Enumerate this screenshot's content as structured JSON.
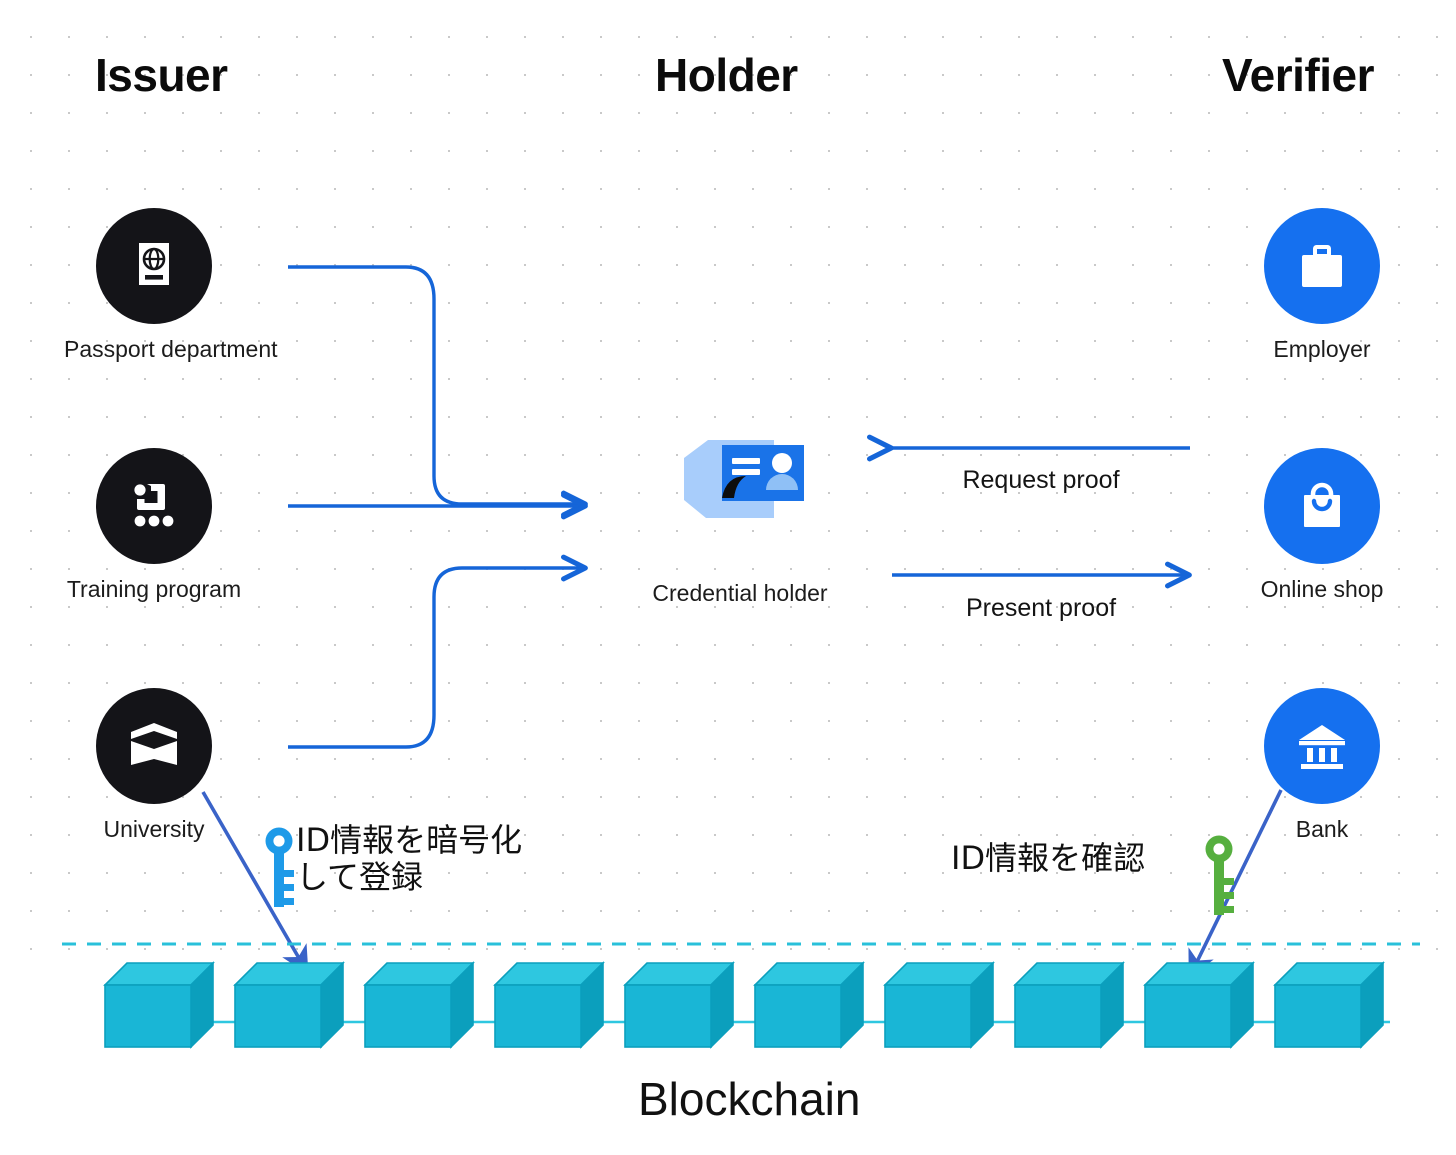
{
  "diagram": {
    "columns": [
      {
        "id": "issuer",
        "title": "Issuer"
      },
      {
        "id": "holder",
        "title": "Holder"
      },
      {
        "id": "verifier",
        "title": "Verifier"
      }
    ],
    "issuers": [
      {
        "label": "Passport department",
        "icon": "passport-icon"
      },
      {
        "label": "Training program",
        "icon": "training-icon"
      },
      {
        "label": "University",
        "icon": "graduation-cap-icon"
      }
    ],
    "holder": {
      "label": "Credential holder",
      "icon": "id-card-in-hand-icon"
    },
    "verifiers": [
      {
        "label": "Employer",
        "icon": "briefcase-icon"
      },
      {
        "label": "Online shop",
        "icon": "shopping-bag-icon"
      },
      {
        "label": "Bank",
        "icon": "bank-building-icon"
      }
    ],
    "flows": [
      {
        "id": "request-proof",
        "label": "Request proof",
        "direction": "verifier-to-holder"
      },
      {
        "id": "present-proof",
        "label": "Present proof",
        "direction": "holder-to-verifier"
      }
    ],
    "notes": [
      {
        "id": "register-note",
        "text": "ID情報を暗号化\nして登録",
        "key_icon": "key-icon",
        "key_color": "#1e9ae8"
      },
      {
        "id": "verify-note",
        "text": "ID情報を確認",
        "key_icon": "key-icon",
        "key_color": "#56af3f"
      }
    ],
    "blockchain": {
      "label": "Blockchain",
      "block_count": 10,
      "block_color": "#19b6d6",
      "block_top_color": "#2ec7e0",
      "block_side_color": "#0b9fbd",
      "chain_line_color": "#2ec7e0",
      "divider_color": "#29c0da"
    },
    "colors": {
      "issuer_disc": "#141418",
      "verifier_disc": "#1570ef",
      "arrow_blue": "#1565d8",
      "note_arrow_blue": "#3a63c8",
      "text": "#111111"
    }
  }
}
